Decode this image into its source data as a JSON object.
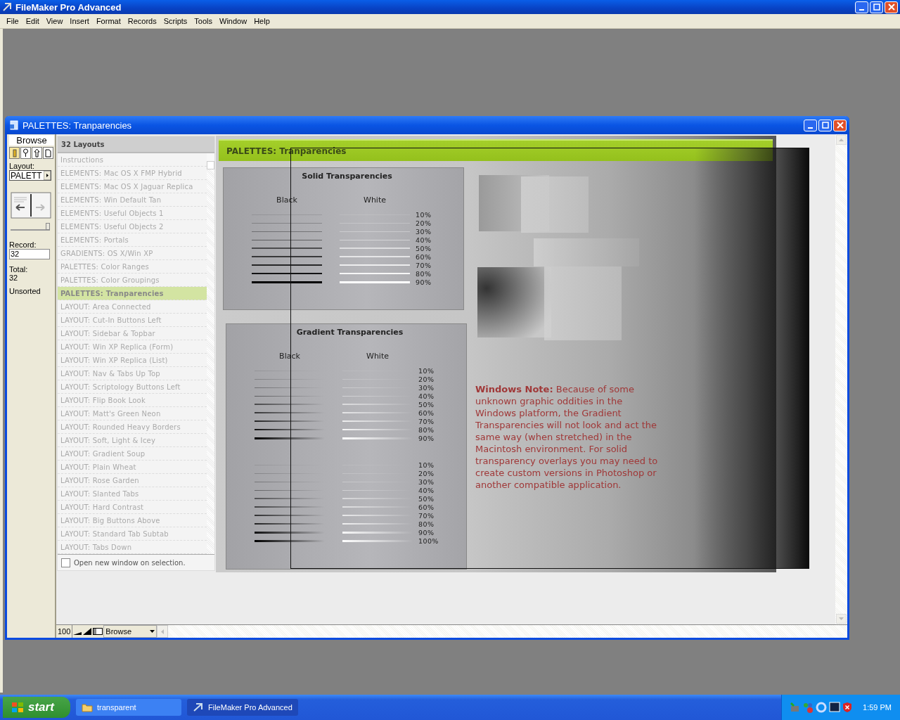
{
  "app": {
    "title": "FileMaker Pro Advanced"
  },
  "menu": [
    "File",
    "Edit",
    "View",
    "Insert",
    "Format",
    "Records",
    "Scripts",
    "Tools",
    "Window",
    "Help"
  ],
  "window": {
    "title": "PALETTES: Tranparencies"
  },
  "status_area": {
    "mode": "Browse",
    "layout_label": "Layout:",
    "layout_value": "PALETT",
    "slider": {
      "level": 1
    },
    "record_label": "Record:",
    "record_value": "32",
    "total_label": "Total:",
    "total_value": "32",
    "sort_state": "Unsorted"
  },
  "layout_list": {
    "header": "32 Layouts",
    "items": [
      {
        "label": "Instructions",
        "selected": false
      },
      {
        "label": "ELEMENTS: Mac OS X FMP Hybrid",
        "selected": false
      },
      {
        "label": "ELEMENTS: Mac OS X Jaguar Replica",
        "selected": false
      },
      {
        "label": "ELEMENTS: Win Default Tan",
        "selected": false
      },
      {
        "label": "ELEMENTS: Useful Objects 1",
        "selected": false
      },
      {
        "label": "ELEMENTS: Useful Objects 2",
        "selected": false
      },
      {
        "label": "ELEMENTS: Portals",
        "selected": false
      },
      {
        "label": "GRADIENTS: OS X/Win XP",
        "selected": false
      },
      {
        "label": "PALETTES: Color Ranges",
        "selected": false
      },
      {
        "label": "PALETTES: Color Groupings",
        "selected": false
      },
      {
        "label": "PALETTES: Tranparencies",
        "selected": true
      },
      {
        "label": "LAYOUT: Area Connected",
        "selected": false
      },
      {
        "label": "LAYOUT: Cut-In Buttons Left",
        "selected": false
      },
      {
        "label": "LAYOUT: Sidebar & Topbar",
        "selected": false
      },
      {
        "label": "LAYOUT: Win XP Replica (Form)",
        "selected": false
      },
      {
        "label": "LAYOUT: Win XP Replica (List)",
        "selected": false
      },
      {
        "label": "LAYOUT: Nav & Tabs Up Top",
        "selected": false
      },
      {
        "label": "LAYOUT: Scriptology Buttons Left",
        "selected": false
      },
      {
        "label": "LAYOUT: Flip Book Look",
        "selected": false
      },
      {
        "label": "LAYOUT: Matt's Green Neon",
        "selected": false
      },
      {
        "label": "LAYOUT: Rounded Heavy Borders",
        "selected": false
      },
      {
        "label": "LAYOUT: Soft, Light & Icey",
        "selected": false
      },
      {
        "label": "LAYOUT: Gradient Soup",
        "selected": false
      },
      {
        "label": "LAYOUT: Plain Wheat",
        "selected": false
      },
      {
        "label": "LAYOUT: Rose Garden",
        "selected": false
      },
      {
        "label": "LAYOUT: Slanted Tabs",
        "selected": false
      },
      {
        "label": "LAYOUT: Hard Contrast",
        "selected": false
      },
      {
        "label": "LAYOUT: Big Buttons Above",
        "selected": false
      },
      {
        "label": "LAYOUT: Standard Tab Subtab",
        "selected": false
      },
      {
        "label": "LAYOUT: Tabs Down",
        "selected": false
      }
    ],
    "checkbox": {
      "label": "Open new window on selection.",
      "checked": false
    }
  },
  "content": {
    "header": "PALETTES: Tranparencies",
    "solid": {
      "title": "Solid Transparencies",
      "black_label": "Black",
      "white_label": "White",
      "groups": [
        [
          "10%",
          "20%",
          "30%",
          "40%",
          "50%",
          "60%",
          "70%",
          "80%",
          "90%"
        ]
      ]
    },
    "gradient": {
      "title": "Gradient Transparencies",
      "black_label": "Black",
      "white_label": "White",
      "groups": [
        [
          "10%",
          "20%",
          "30%",
          "40%",
          "50%",
          "60%",
          "70%",
          "80%",
          "90%"
        ],
        [
          "10%",
          "20%",
          "30%",
          "40%",
          "50%",
          "60%",
          "70%",
          "80%",
          "90%",
          "100%"
        ]
      ]
    },
    "note": "**Windows Note:** Because of some unknown graphic oddities in the Windows platform, the Gradient Transparencies will not look and act the same way (when stretched) in the Macintosh environment. For solid transparency overlays you may need to create custom versions in Photoshop or another compatible application."
  },
  "bottom_bar": {
    "zoom": "100",
    "mode": "Browse"
  },
  "taskbar": {
    "start": "start",
    "tasks": [
      {
        "label": "transparent",
        "selected": false
      },
      {
        "label": "FileMaker Pro Advanced",
        "selected": true
      }
    ],
    "clock": "1:59 PM"
  }
}
